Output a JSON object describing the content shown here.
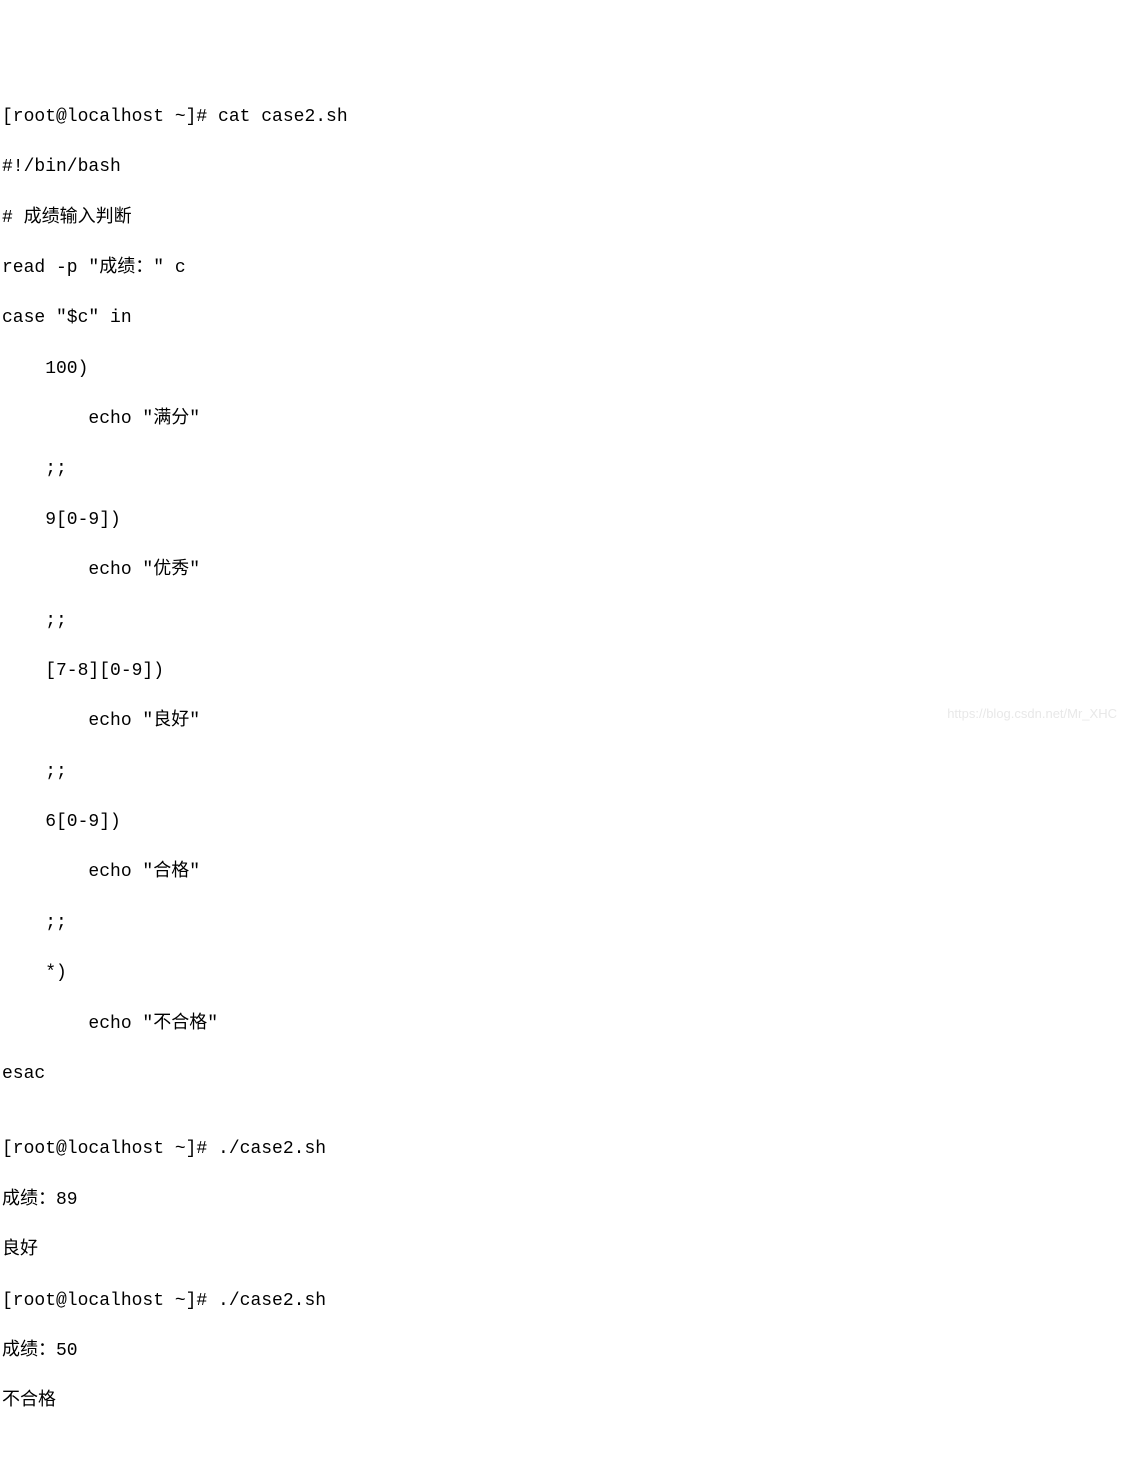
{
  "terminal": {
    "lines": [
      "[root@localhost ~]# cat case2.sh",
      "#!/bin/bash",
      "# 成绩输入判断",
      "read -p \"成绩：\" c",
      "case \"$c\" in",
      "    100)",
      "        echo \"满分\"",
      "    ;;",
      "    9[0-9])",
      "        echo \"优秀\"",
      "    ;;",
      "    [7-8][0-9])",
      "        echo \"良好\"",
      "    ;;",
      "    6[0-9])",
      "        echo \"合格\"",
      "    ;;",
      "    *)",
      "        echo \"不合格\"",
      "esac",
      "",
      "[root@localhost ~]# ./case2.sh",
      "成绩：89",
      "良好",
      "[root@localhost ~]# ./case2.sh",
      "成绩：50",
      "不合格"
    ]
  },
  "watermark": "https://blog.csdn.net/Mr_XHC"
}
